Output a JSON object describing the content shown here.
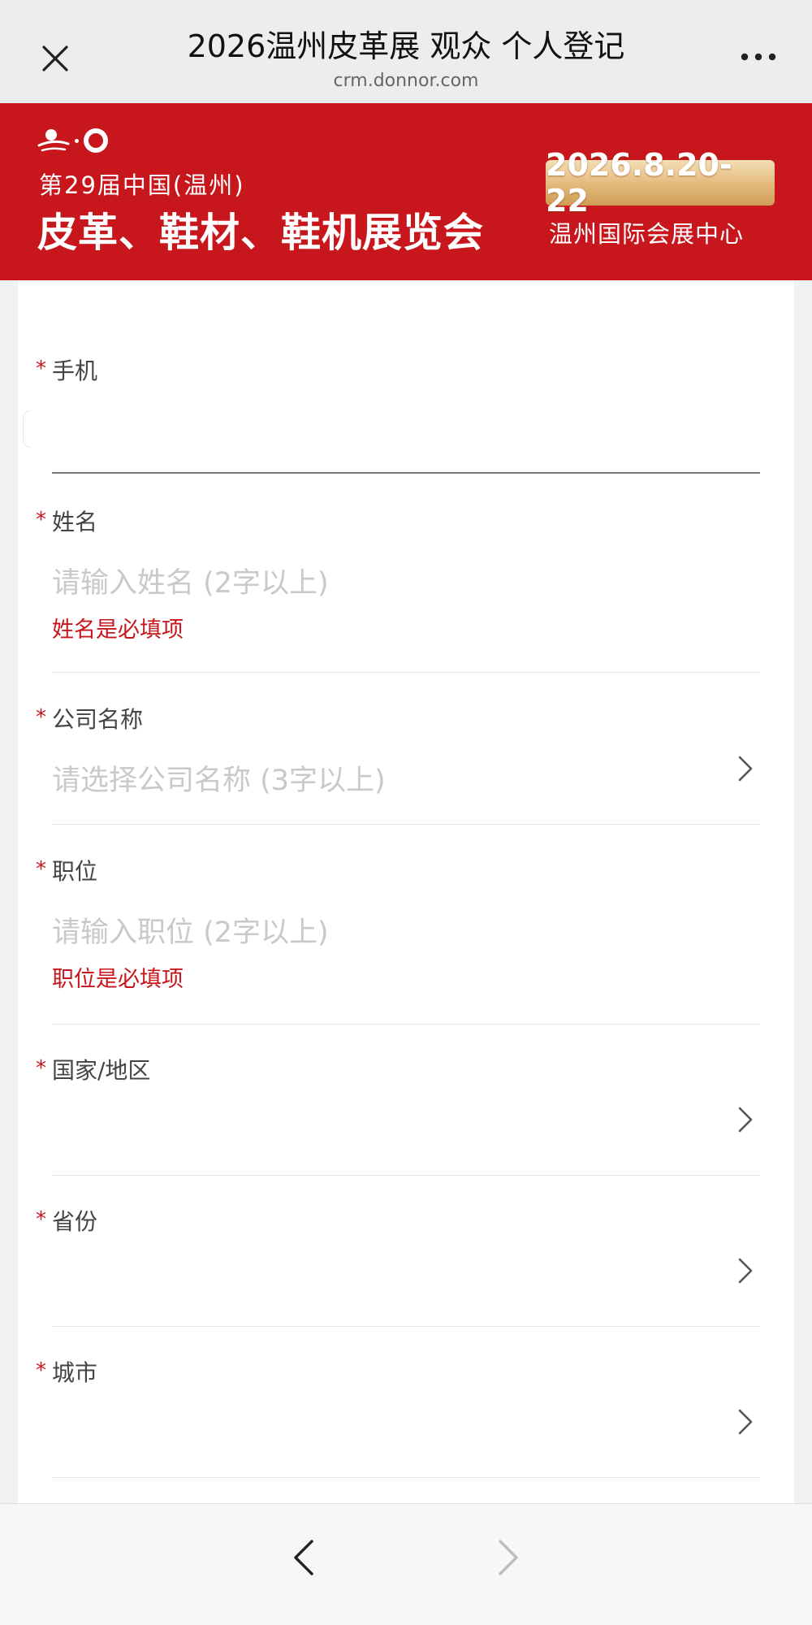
{
  "header": {
    "title": "2026温州皮革展 观众 个人登记",
    "domain": "crm.donnor.com",
    "close_icon": "close-icon",
    "more_icon": "more-icon"
  },
  "banner": {
    "session": "第29届中国(温州)",
    "expo_name": "皮革、鞋材、鞋机展览会",
    "date": "2026.8.20-22",
    "venue": "温州国际会展中心",
    "colors": {
      "background": "#c8161d",
      "badge": "#e2b97a"
    }
  },
  "form": {
    "required_mark": "*",
    "fields": [
      {
        "label": "手机",
        "value": "",
        "placeholder": ""
      },
      {
        "label": "姓名",
        "placeholder": "请输入姓名 (2字以上)",
        "error": "姓名是必填项"
      },
      {
        "label": "公司名称",
        "placeholder": "请选择公司名称 (3字以上)"
      },
      {
        "label": "职位",
        "placeholder": "请输入职位 (2字以上)",
        "error": "职位是必填项"
      },
      {
        "label": "国家/地区",
        "placeholder": ""
      },
      {
        "label": "省份",
        "placeholder": ""
      },
      {
        "label": "城市",
        "placeholder": ""
      }
    ],
    "error_color": "#c8161d"
  },
  "footer": {
    "back_icon": "chevron-left-icon",
    "forward_icon": "chevron-right-icon"
  }
}
